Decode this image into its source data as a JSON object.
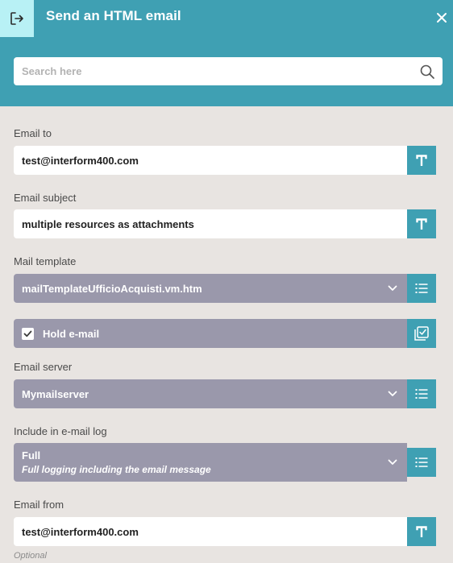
{
  "header": {
    "title": "Send an HTML email",
    "exit_icon": "exit-icon",
    "close_icon": "close-icon",
    "search_placeholder": "Search here",
    "search_icon": "search-icon"
  },
  "fields": {
    "email_to": {
      "label": "Email to",
      "value": "test@interform400.com",
      "side_icon": "text-type-icon"
    },
    "email_subject": {
      "label": "Email subject",
      "value": "multiple resources as attachments",
      "side_icon": "text-type-icon"
    },
    "mail_template": {
      "label": "Mail template",
      "value": "mailTemplateUfficioAcquisti.vm.htm",
      "side_icon": "list-icon"
    },
    "hold_email": {
      "label": "Hold e-mail",
      "checked": true,
      "side_icon": "checkbox-list-icon"
    },
    "email_server": {
      "label": "Email server",
      "value": "Mymailserver",
      "side_icon": "list-icon"
    },
    "email_log": {
      "label": "Include in e-mail log",
      "value": "Full",
      "description": "Full logging including the email message",
      "side_icon": "list-icon"
    },
    "email_from": {
      "label": "Email from",
      "value": "test@interform400.com",
      "hint": "Optional",
      "side_icon": "text-type-icon"
    }
  },
  "colors": {
    "header": "#3fa0b3",
    "accent_box": "#b8f1f5",
    "select_bg": "#9a98ab",
    "page_bg": "#e8e4e1"
  }
}
